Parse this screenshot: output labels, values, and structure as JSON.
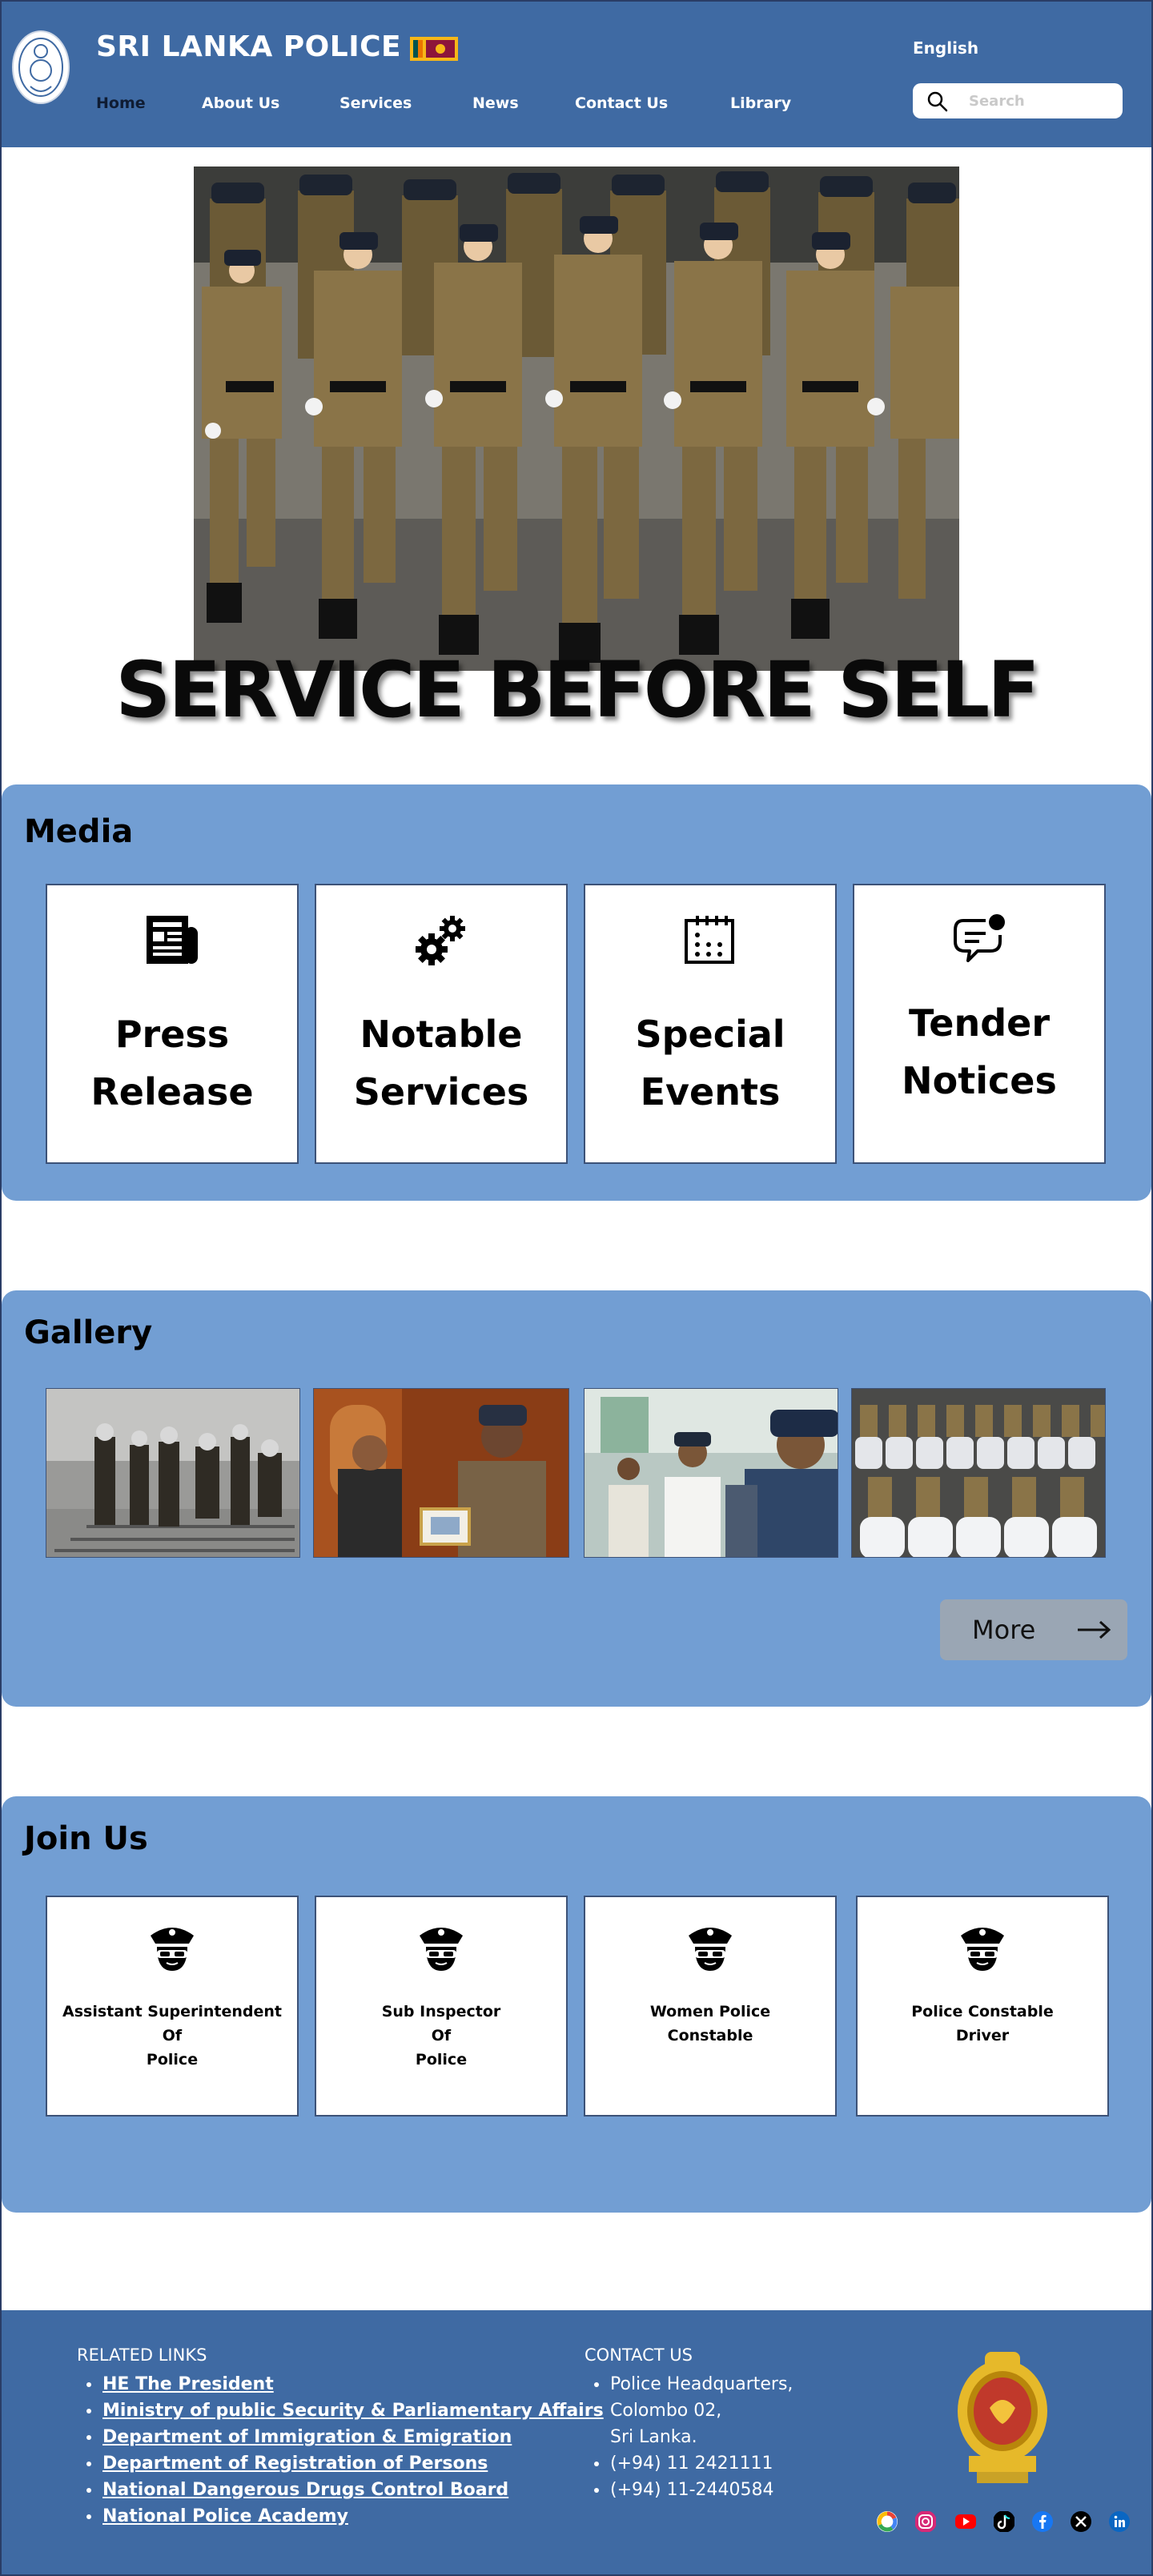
{
  "header": {
    "title": "SRI LANKA POLICE",
    "language": "English",
    "search_placeholder": "Search",
    "nav": [
      "Home",
      "About Us",
      "Services",
      "News",
      "Contact Us",
      "Library"
    ]
  },
  "hero": {
    "tagline": "SERVICE BEFORE SELF"
  },
  "media": {
    "title": "Media",
    "cards": [
      {
        "line1": "Press",
        "line2": "Release",
        "icon": "newspaper-icon"
      },
      {
        "line1": "Notable",
        "line2": "Services",
        "icon": "gears-icon"
      },
      {
        "line1": "Special",
        "line2": "Events",
        "icon": "calendar-icon"
      },
      {
        "line1": "Tender",
        "line2": "Notices",
        "icon": "chat-notification-icon"
      }
    ]
  },
  "gallery": {
    "title": "Gallery",
    "more_label": "More"
  },
  "join": {
    "title": "Join Us",
    "cards": [
      "Assistant Superintendent\nOf\nPolice",
      "Sub Inspector\nOf\nPolice",
      "Women Police\nConstable",
      "Police Constable\nDriver"
    ]
  },
  "footer": {
    "related_title": "RELATED LINKS",
    "related_links": [
      "HE The President",
      "Ministry of public Security & Parliamentary Affairs",
      "Department of Immigration & Emigration",
      "Department of Registration of Persons",
      "National Dangerous Drugs Control Board",
      "National Police Academy"
    ],
    "contact_title": "CONTACT US",
    "address": [
      "Police Headquarters,",
      "Colombo 02,",
      "Sri Lanka."
    ],
    "phones": [
      "(+94) 11 2421111",
      "(+94) 11-2440584"
    ],
    "social": [
      "google-icon",
      "instagram-icon",
      "youtube-icon",
      "tiktok-icon",
      "facebook-icon",
      "x-icon",
      "linkedin-icon"
    ]
  },
  "colors": {
    "header_bg": "#3f6aa3",
    "section_bg": "#729ed3",
    "footer_bg": "#3f6aa3"
  }
}
